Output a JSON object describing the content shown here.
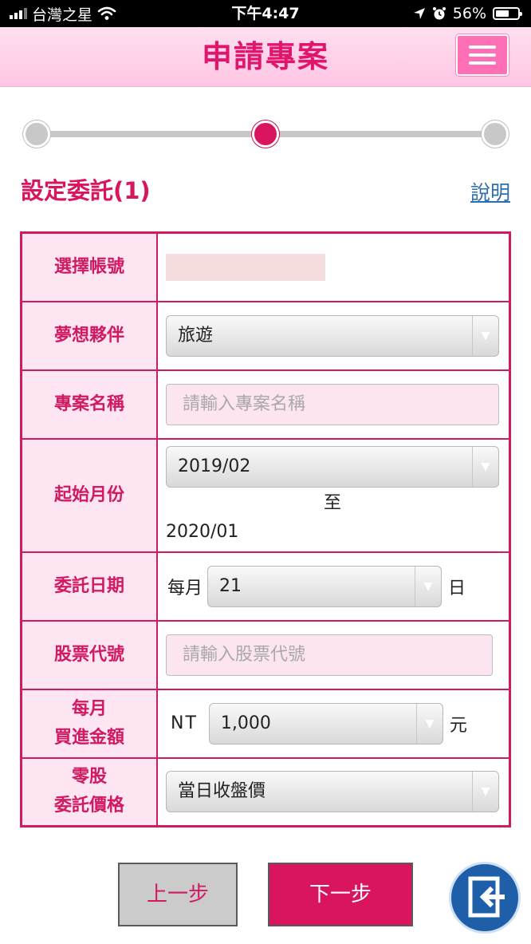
{
  "status_bar": {
    "carrier": "台灣之星",
    "time": "下午4:47",
    "battery": "56%"
  },
  "header": {
    "title": "申請專案"
  },
  "stepper": {
    "total_steps": 3,
    "current_step": 2
  },
  "section": {
    "title": "設定委託(1)",
    "help_link": "說明"
  },
  "form": {
    "account": {
      "label": "選擇帳號"
    },
    "dream_partner": {
      "label": "夢想夥伴",
      "value": "旅遊"
    },
    "project_name": {
      "label": "專案名稱",
      "placeholder": "請輸入專案名稱"
    },
    "start_month": {
      "label": "起始月份",
      "value": "2019/02",
      "to_label": "至",
      "end_value": "2020/01"
    },
    "order_date": {
      "label": "委託日期",
      "prefix": "每月",
      "value": "21",
      "suffix": "日"
    },
    "stock_code": {
      "label": "股票代號",
      "placeholder": "請輸入股票代號"
    },
    "monthly_amount": {
      "label_line1": "每月",
      "label_line2": "買進金額",
      "prefix": "NT",
      "value": "1,000",
      "suffix": "元"
    },
    "odd_lot_price": {
      "label_line1": "零股",
      "label_line2": "委託價格",
      "value": "當日收盤價"
    }
  },
  "buttons": {
    "prev": "上一步",
    "next": "下一步"
  },
  "colors": {
    "brand": "#d8155e",
    "header_bg": "#ffc6e3",
    "menu_button": "#ff6fb5",
    "link": "#2d6db0",
    "logout_button": "#1f5fa9"
  }
}
